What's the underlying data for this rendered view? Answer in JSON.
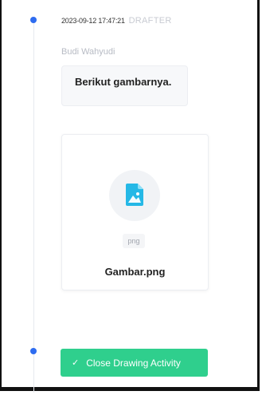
{
  "entry": {
    "timestamp": "2023-09-12 17:47:21",
    "role": "DRAFTER",
    "author": "Budi Wahyudi",
    "message": "Berikut gambarnya."
  },
  "attachment": {
    "extension": "png",
    "file_name": "Gambar.png",
    "icon": "image-file-icon"
  },
  "actions": {
    "close_label": "Close Drawing Activity",
    "close_icon": "check-icon"
  },
  "colors": {
    "accent": "#2e6cf0",
    "success": "#2fcf8d",
    "file_icon": "#25b8e6"
  }
}
